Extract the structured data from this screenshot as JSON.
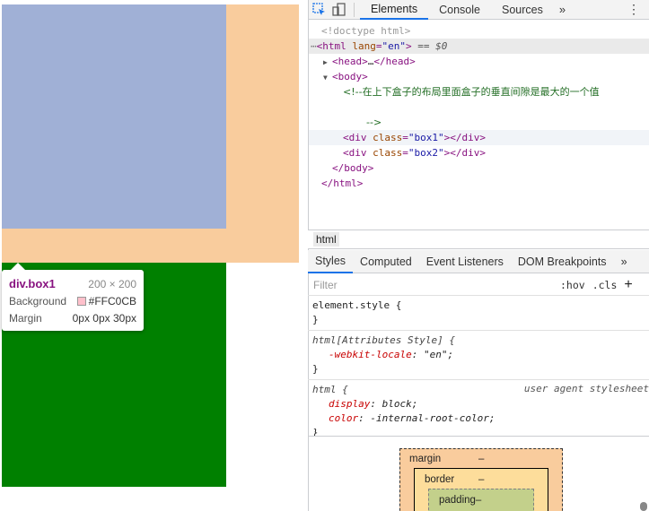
{
  "tooltip": {
    "element": "div.box1",
    "size": "200 × 200",
    "rows": [
      {
        "label": "Background",
        "value": "#FFC0CB",
        "swatch": "#ffc0cb"
      },
      {
        "label": "Margin",
        "value": "0px 0px 30px"
      }
    ]
  },
  "devtools": {
    "tabs": [
      "Elements",
      "Console",
      "Sources"
    ],
    "active_tab": "Elements",
    "more": "»",
    "menu": "⋮"
  },
  "dom": {
    "doctype": "<!doctype html>",
    "html_open_tag": "html",
    "html_attr_name": "lang",
    "html_attr_value": "\"en\"",
    "selected_marker": "== $0",
    "head": "head",
    "head_ellipsis": "…",
    "body": "body",
    "comment_line1": "<!--在上下盒子的布局里面盒子的垂直间隙是最大的一个值",
    "comment_line2": "-->",
    "div1_class": "\"box1\"",
    "div2_class": "\"box2\"",
    "div_tag": "div",
    "class_attr": "class",
    "body_close": "body",
    "html_close": "html"
  },
  "breadcrumb": "html",
  "subtabs": [
    "Styles",
    "Computed",
    "Event Listeners",
    "DOM Breakpoints"
  ],
  "subtabs_more": "»",
  "filter": {
    "placeholder": "Filter",
    "hov": ":hov",
    "cls": ".cls",
    "plus": "+"
  },
  "styles": {
    "rule1": {
      "selector": "element.style {",
      "close": "}"
    },
    "rule2": {
      "selector": "html[Attributes Style] {",
      "prop": "-webkit-locale",
      "value": "\"en\";",
      "close": "}"
    },
    "rule3": {
      "selector": "html {",
      "origin": "user agent stylesheet",
      "decls": [
        {
          "prop": "display",
          "value": "block;"
        },
        {
          "prop": "color",
          "value": "-internal-root-color;"
        }
      ],
      "close": "}"
    }
  },
  "boxmodel": {
    "margin_label": "margin",
    "margin_value": "–",
    "border_label": "border",
    "border_value": "–",
    "padding_label": "padding–"
  }
}
